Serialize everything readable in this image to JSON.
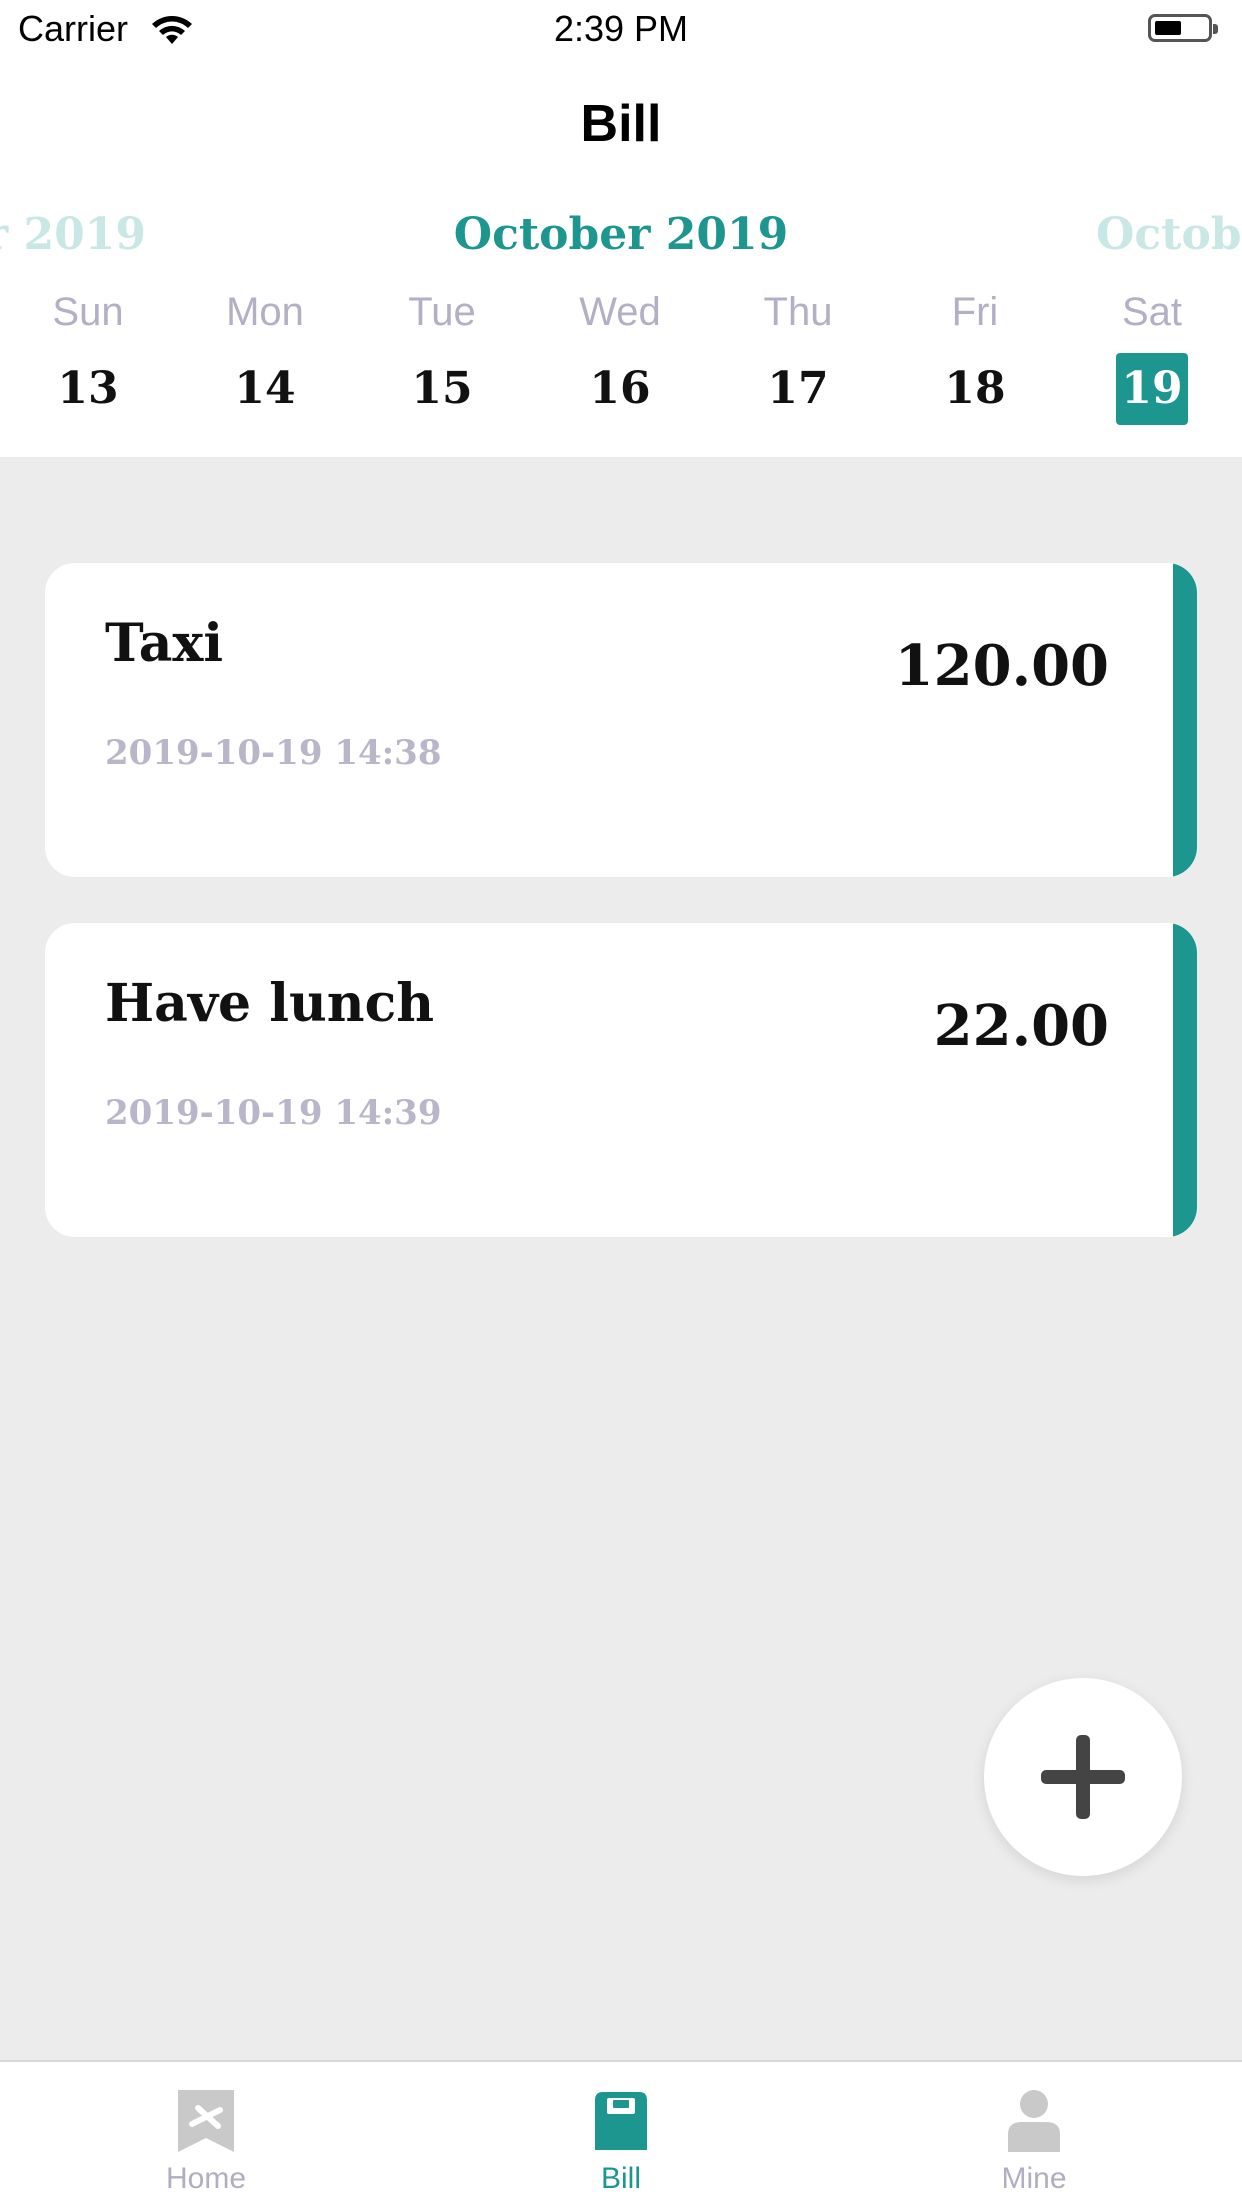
{
  "status_bar": {
    "carrier": "Carrier",
    "time": "2:39 PM"
  },
  "nav": {
    "title": "Bill"
  },
  "calendar": {
    "prev_month": "er 2019",
    "current_month": "October 2019",
    "next_month": "Octobe",
    "days": [
      {
        "dow": "Sun",
        "num": "13"
      },
      {
        "dow": "Mon",
        "num": "14"
      },
      {
        "dow": "Tue",
        "num": "15"
      },
      {
        "dow": "Wed",
        "num": "16"
      },
      {
        "dow": "Thu",
        "num": "17"
      },
      {
        "dow": "Fri",
        "num": "18"
      },
      {
        "dow": "Sat",
        "num": "19",
        "selected": true
      }
    ]
  },
  "bills": [
    {
      "title": "Taxi",
      "amount": "120.00",
      "time": "2019-10-19 14:38"
    },
    {
      "title": "Have lunch",
      "amount": "22.00",
      "time": "2019-10-19 14:39"
    }
  ],
  "fab": {
    "icon": "plus-icon"
  },
  "tabs": [
    {
      "label": "Home",
      "icon": "home-ticket-icon",
      "active": false
    },
    {
      "label": "Bill",
      "icon": "bill-clipboard-icon",
      "active": true
    },
    {
      "label": "Mine",
      "icon": "person-icon",
      "active": false
    }
  ],
  "colors": {
    "accent": "#1e9690",
    "accent_faded": "#c9e7e5",
    "muted_text": "#b3b0c6",
    "background": "#ececec",
    "fab_icon": "#444444"
  }
}
